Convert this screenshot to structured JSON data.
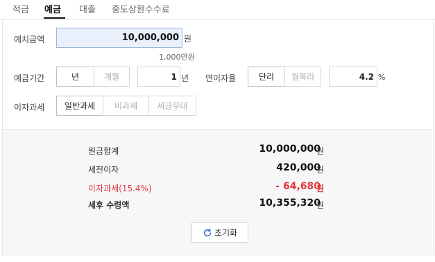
{
  "tabs": [
    {
      "label": "적금"
    },
    {
      "label": "예금"
    },
    {
      "label": "대출"
    },
    {
      "label": "중도상환수수료"
    }
  ],
  "active_tab": "예금",
  "form": {
    "deposit_amount": {
      "label": "예치금액",
      "value": "10,000,000",
      "unit": "원",
      "hint": "1,000만원"
    },
    "period": {
      "label": "예금기간",
      "options": [
        "년",
        "개월"
      ],
      "selected": "년",
      "value": "1",
      "unit": "년"
    },
    "rate": {
      "label": "연이자율",
      "options": [
        "단리",
        "월복리"
      ],
      "selected": "단리",
      "value": "4.2",
      "unit": "%"
    },
    "tax": {
      "label": "이자과세",
      "options": [
        "일반과세",
        "비과세",
        "세금우대"
      ],
      "selected": "일반과세"
    }
  },
  "result": {
    "principal": {
      "label": "원금합계",
      "value": "10,000,000",
      "unit": "원"
    },
    "pretax_interest": {
      "label": "세전이자",
      "value": "420,000",
      "unit": "원"
    },
    "interest_tax": {
      "label": "이자과세(15.4%)",
      "value": "- 64,680",
      "unit": "원"
    },
    "after_tax": {
      "label": "세후 수령액",
      "value": "10,355,320",
      "unit": "원"
    }
  },
  "reset_button": {
    "label": "초기화",
    "icon": "refresh-icon"
  },
  "colors": {
    "accent_red": "#e0383e",
    "input_highlight": "#e9f0fb",
    "result_bg": "#f7f7f7"
  }
}
